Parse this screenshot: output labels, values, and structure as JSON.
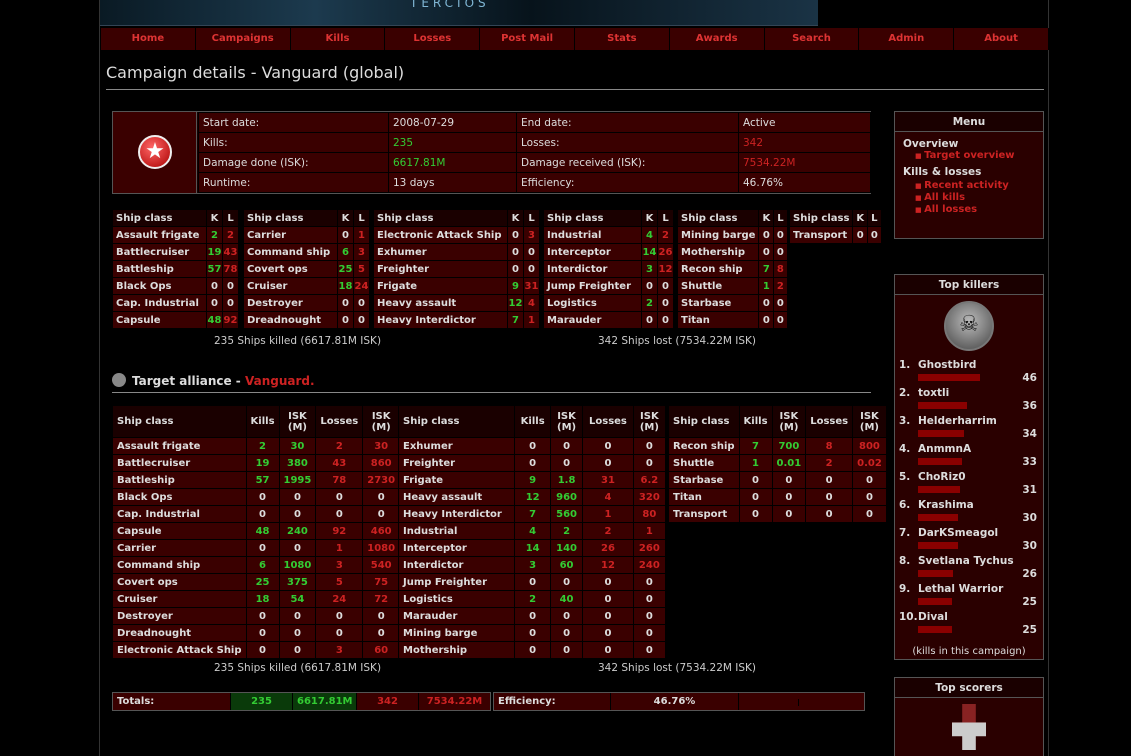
{
  "banner": {
    "logo": "TERCIOS"
  },
  "nav": [
    "Home",
    "Campaigns",
    "Kills",
    "Losses",
    "Post Mail",
    "Stats",
    "Awards",
    "Search",
    "Admin",
    "About"
  ],
  "page_title": "Campaign details - Vanguard (global)",
  "info": {
    "start_label": "Start date:",
    "start": "2008-07-29",
    "end_label": "End date:",
    "end": "Active",
    "kills_label": "Kills:",
    "kills": "235",
    "losses_label": "Losses:",
    "losses": "342",
    "dmg_done_label": "Damage done (ISK):",
    "dmg_done": "6617.81M",
    "dmg_recv_label": "Damage received (ISK):",
    "dmg_recv": "7534.22M",
    "runtime_label": "Runtime:",
    "runtime": "13 days",
    "eff_label": "Efficiency:",
    "eff": "46.76%"
  },
  "mini_header": {
    "cls": "Ship class",
    "k": "K",
    "l": "L"
  },
  "mini_tables": [
    [
      [
        "Assault frigate",
        "2",
        "2"
      ],
      [
        "Battlecruiser",
        "19",
        "43"
      ],
      [
        "Battleship",
        "57",
        "78"
      ],
      [
        "Black Ops",
        "0",
        "0"
      ],
      [
        "Cap. Industrial",
        "0",
        "0"
      ],
      [
        "Capsule",
        "48",
        "92"
      ]
    ],
    [
      [
        "Carrier",
        "0",
        "1"
      ],
      [
        "Command ship",
        "6",
        "3"
      ],
      [
        "Covert ops",
        "25",
        "5"
      ],
      [
        "Cruiser",
        "18",
        "24"
      ],
      [
        "Destroyer",
        "0",
        "0"
      ],
      [
        "Dreadnought",
        "0",
        "0"
      ]
    ],
    [
      [
        "Electronic Attack Ship",
        "0",
        "3"
      ],
      [
        "Exhumer",
        "0",
        "0"
      ],
      [
        "Freighter",
        "0",
        "0"
      ],
      [
        "Frigate",
        "9",
        "31"
      ],
      [
        "Heavy assault",
        "12",
        "4"
      ],
      [
        "Heavy Interdictor",
        "7",
        "1"
      ]
    ],
    [
      [
        "Industrial",
        "4",
        "2"
      ],
      [
        "Interceptor",
        "14",
        "26"
      ],
      [
        "Interdictor",
        "3",
        "12"
      ],
      [
        "Jump Freighter",
        "0",
        "0"
      ],
      [
        "Logistics",
        "2",
        "0"
      ],
      [
        "Marauder",
        "0",
        "0"
      ]
    ],
    [
      [
        "Mining barge",
        "0",
        "0"
      ],
      [
        "Mothership",
        "0",
        "0"
      ],
      [
        "Recon ship",
        "7",
        "8"
      ],
      [
        "Shuttle",
        "1",
        "2"
      ],
      [
        "Starbase",
        "0",
        "0"
      ],
      [
        "Titan",
        "0",
        "0"
      ]
    ],
    [
      [
        "Transport",
        "0",
        "0"
      ]
    ]
  ],
  "caption_killed": "235 Ships killed (6617.81M ISK)",
  "caption_lost": "342 Ships lost (7534.22M ISK)",
  "alliance": {
    "label": "Target alliance - ",
    "name": "Vanguard."
  },
  "big_header": {
    "cls": "Ship class",
    "kills": "Kills",
    "isk1": "ISK",
    "m": "(M)",
    "losses": "Losses",
    "isk2": "ISK"
  },
  "big_tables": [
    [
      [
        "Assault frigate",
        "2",
        "30",
        "2",
        "30"
      ],
      [
        "Battlecruiser",
        "19",
        "380",
        "43",
        "860"
      ],
      [
        "Battleship",
        "57",
        "1995",
        "78",
        "2730"
      ],
      [
        "Black Ops",
        "0",
        "0",
        "0",
        "0"
      ],
      [
        "Cap. Industrial",
        "0",
        "0",
        "0",
        "0"
      ],
      [
        "Capsule",
        "48",
        "240",
        "92",
        "460"
      ],
      [
        "Carrier",
        "0",
        "0",
        "1",
        "1080"
      ],
      [
        "Command ship",
        "6",
        "1080",
        "3",
        "540"
      ],
      [
        "Covert ops",
        "25",
        "375",
        "5",
        "75"
      ],
      [
        "Cruiser",
        "18",
        "54",
        "24",
        "72"
      ],
      [
        "Destroyer",
        "0",
        "0",
        "0",
        "0"
      ],
      [
        "Dreadnought",
        "0",
        "0",
        "0",
        "0"
      ],
      [
        "Electronic Attack Ship",
        "0",
        "0",
        "3",
        "60"
      ]
    ],
    [
      [
        "Exhumer",
        "0",
        "0",
        "0",
        "0"
      ],
      [
        "Freighter",
        "0",
        "0",
        "0",
        "0"
      ],
      [
        "Frigate",
        "9",
        "1.8",
        "31",
        "6.2"
      ],
      [
        "Heavy assault",
        "12",
        "960",
        "4",
        "320"
      ],
      [
        "Heavy Interdictor",
        "7",
        "560",
        "1",
        "80"
      ],
      [
        "Industrial",
        "4",
        "2",
        "2",
        "1"
      ],
      [
        "Interceptor",
        "14",
        "140",
        "26",
        "260"
      ],
      [
        "Interdictor",
        "3",
        "60",
        "12",
        "240"
      ],
      [
        "Jump Freighter",
        "0",
        "0",
        "0",
        "0"
      ],
      [
        "Logistics",
        "2",
        "40",
        "0",
        "0"
      ],
      [
        "Marauder",
        "0",
        "0",
        "0",
        "0"
      ],
      [
        "Mining barge",
        "0",
        "0",
        "0",
        "0"
      ],
      [
        "Mothership",
        "0",
        "0",
        "0",
        "0"
      ]
    ],
    [
      [
        "Recon ship",
        "7",
        "700",
        "8",
        "800"
      ],
      [
        "Shuttle",
        "1",
        "0.01",
        "2",
        "0.02"
      ],
      [
        "Starbase",
        "0",
        "0",
        "0",
        "0"
      ],
      [
        "Titan",
        "0",
        "0",
        "0",
        "0"
      ],
      [
        "Transport",
        "0",
        "0",
        "0",
        "0"
      ]
    ]
  ],
  "totals": {
    "label": "Totals:",
    "kills": "235",
    "isk_k": "6617.81M",
    "losses": "342",
    "isk_l": "7534.22M"
  },
  "efficiency": {
    "label": "Efficiency:",
    "value": "46.76%",
    "fraction": 0.4676
  },
  "menu": {
    "title": "Menu",
    "overview": "Overview",
    "target_overview": "Target overview",
    "kills_losses": "Kills & losses",
    "recent": "Recent activity",
    "all_kills": "All kills",
    "all_losses": "All losses"
  },
  "top_killers": {
    "title": "Top killers",
    "footer": "(kills in this campaign)",
    "entries": [
      {
        "rank": "1.",
        "name": "Ghostbird",
        "kills": 46
      },
      {
        "rank": "2.",
        "name": "toxtli",
        "kills": 36
      },
      {
        "rank": "3.",
        "name": "Helderharrim",
        "kills": 34
      },
      {
        "rank": "4.",
        "name": "AnmmnA",
        "kills": 33
      },
      {
        "rank": "5.",
        "name": "ChoRiz0",
        "kills": 31
      },
      {
        "rank": "6.",
        "name": "Krashima",
        "kills": 30
      },
      {
        "rank": "7.",
        "name": "DarKSmeagol",
        "kills": 30
      },
      {
        "rank": "8.",
        "name": "Svetlana Tychus",
        "kills": 26
      },
      {
        "rank": "9.",
        "name": "Lethal Warrior",
        "kills": 25
      },
      {
        "rank": "10.",
        "name": "Dival",
        "kills": 25
      }
    ]
  },
  "top_scorers": {
    "title": "Top scorers"
  }
}
